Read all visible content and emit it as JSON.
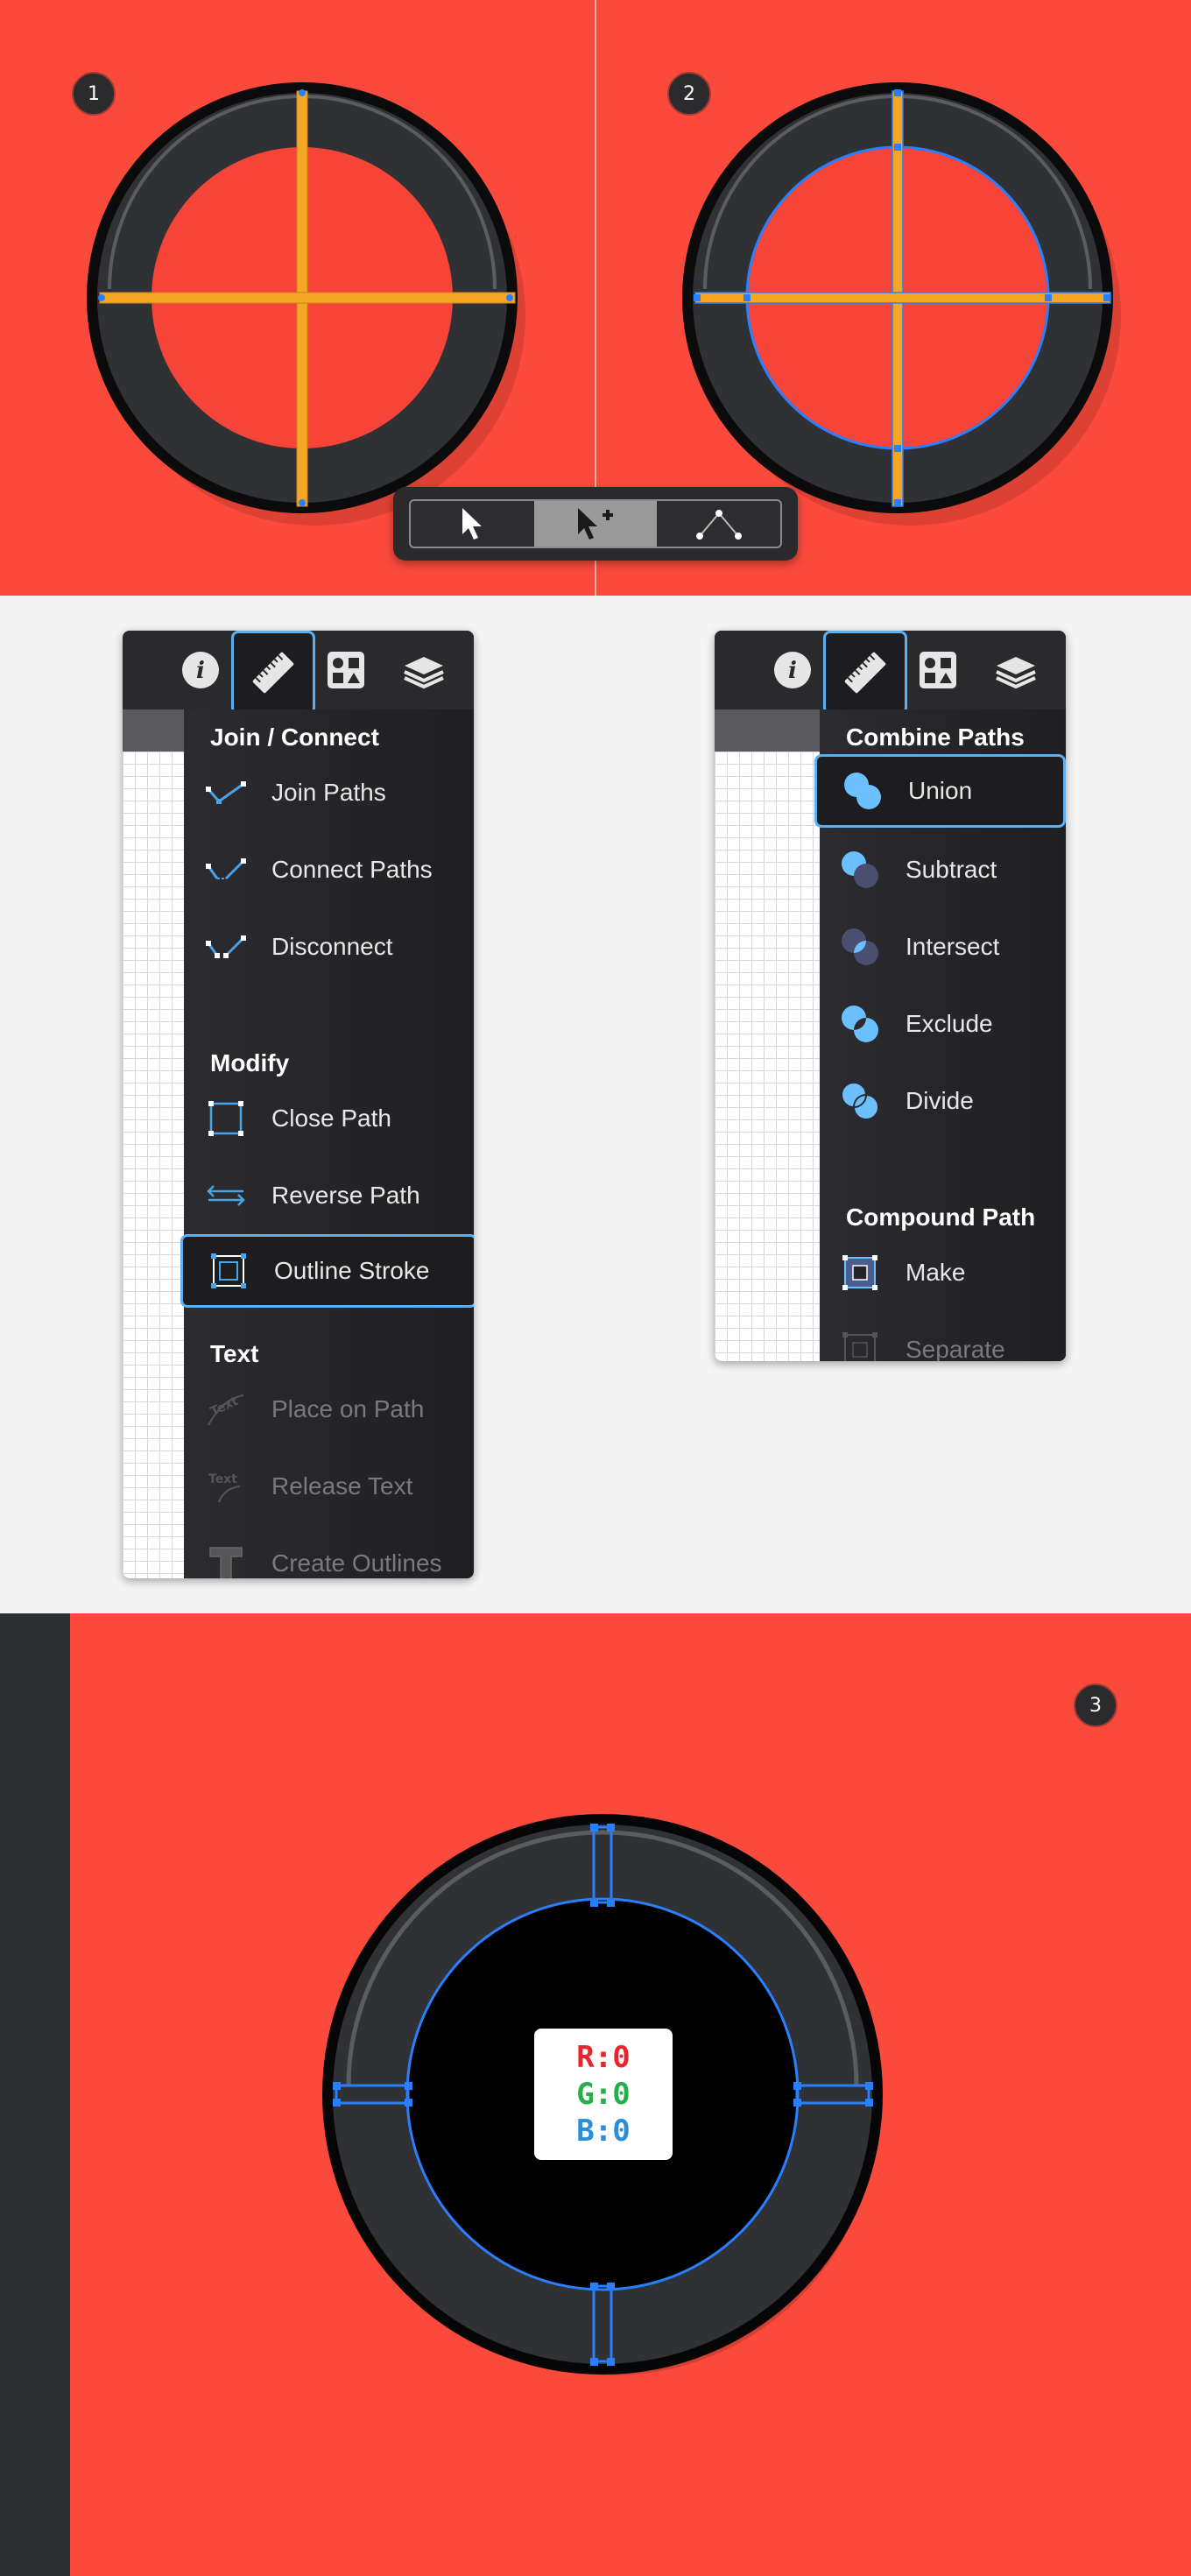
{
  "steps": {
    "step1": "1",
    "step2": "2",
    "step3": "3"
  },
  "colors": {
    "background_red": "#fb4a3c",
    "ring_dark": "#323335",
    "guide_orange": "#f5a623",
    "selection_blue": "#2a7fff",
    "panel_dark": "#252528",
    "highlight_blue": "#5ab0f0"
  },
  "toolbar": {
    "tools": [
      {
        "icon": "selection-arrow-icon",
        "active": false
      },
      {
        "icon": "direct-selection-plus-icon",
        "active": true
      },
      {
        "icon": "node-path-icon",
        "active": false
      }
    ]
  },
  "panel_left": {
    "top_icons": [
      "info-icon",
      "ruler-icon",
      "shapes-icon",
      "layers-icon"
    ],
    "selected_top_icon": "ruler-icon",
    "sections": [
      {
        "title": "Join / Connect",
        "items": [
          {
            "label": "Join Paths",
            "icon": "join-paths-icon",
            "disabled": false
          },
          {
            "label": "Connect Paths",
            "icon": "connect-paths-icon",
            "disabled": false
          },
          {
            "label": "Disconnect",
            "icon": "disconnect-icon",
            "disabled": false
          }
        ]
      },
      {
        "title": "Modify",
        "items": [
          {
            "label": "Close Path",
            "icon": "close-path-icon",
            "disabled": false
          },
          {
            "label": "Reverse Path",
            "icon": "reverse-path-icon",
            "disabled": false
          },
          {
            "label": "Outline Stroke",
            "icon": "outline-stroke-icon",
            "disabled": false,
            "selected": true
          }
        ]
      },
      {
        "title": "Text",
        "items": [
          {
            "label": "Place on Path",
            "icon": "place-on-path-icon",
            "disabled": true
          },
          {
            "label": "Release Text",
            "icon": "release-text-icon",
            "disabled": true
          },
          {
            "label": "Create Outlines",
            "icon": "create-outlines-icon",
            "disabled": true
          }
        ]
      }
    ]
  },
  "panel_right": {
    "top_icons": [
      "info-icon",
      "ruler-icon",
      "shapes-icon",
      "layers-icon"
    ],
    "selected_top_icon": "ruler-icon",
    "sections": [
      {
        "title": "Combine Paths",
        "items": [
          {
            "label": "Union",
            "icon": "union-icon",
            "disabled": false,
            "selected": true
          },
          {
            "label": "Subtract",
            "icon": "subtract-icon",
            "disabled": false
          },
          {
            "label": "Intersect",
            "icon": "intersect-icon",
            "disabled": false
          },
          {
            "label": "Exclude",
            "icon": "exclude-icon",
            "disabled": false
          },
          {
            "label": "Divide",
            "icon": "divide-icon",
            "disabled": false
          }
        ]
      },
      {
        "title": "Compound Path",
        "items": [
          {
            "label": "Make",
            "icon": "make-compound-icon",
            "disabled": false
          },
          {
            "label": "Separate",
            "icon": "separate-compound-icon",
            "disabled": true
          }
        ]
      }
    ]
  },
  "rgb_card": {
    "r": "R:0",
    "g": "G:0",
    "b": "B:0",
    "r_color": "#e8242c",
    "g_color": "#23b04a",
    "b_color": "#2a8fd8"
  }
}
